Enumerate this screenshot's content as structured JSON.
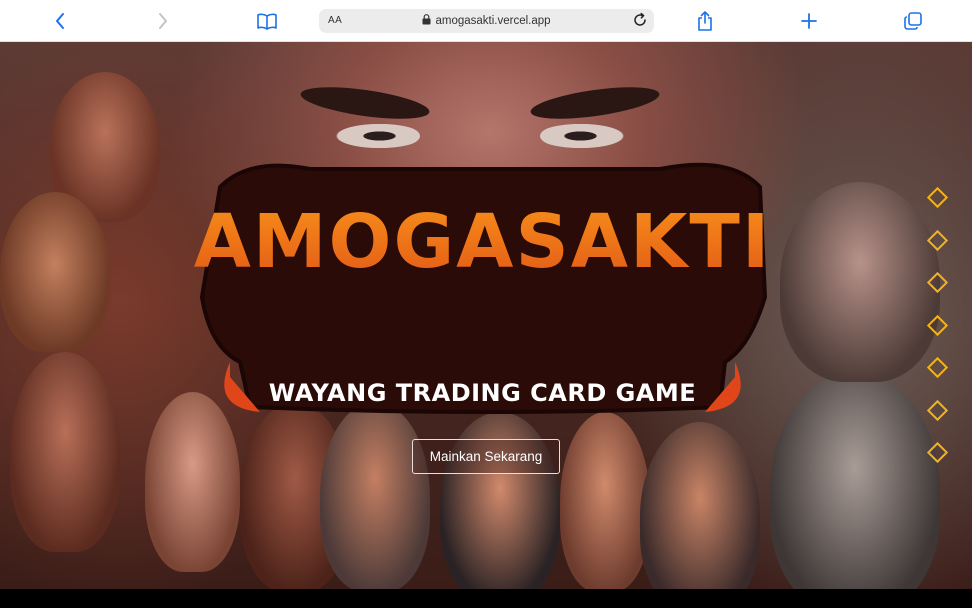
{
  "browser": {
    "aa_label": "AA",
    "url": "amogasakti.vercel.app",
    "icons": {
      "back": "chevron-left-icon",
      "forward": "chevron-right-icon",
      "bookmarks": "book-icon",
      "lock": "lock-icon",
      "reload": "reload-icon",
      "share": "share-icon",
      "new_tab": "plus-icon",
      "tabs": "tabs-icon"
    },
    "accent_color": "#1a73e8"
  },
  "hero": {
    "logo_title": "AMOGASAKTI",
    "logo_subtitle": "WAYANG TRADING CARD GAME",
    "cta_label": "Mainkan Sekarang",
    "nav_dots_count": 7,
    "dot_color": "#f2b31a"
  }
}
